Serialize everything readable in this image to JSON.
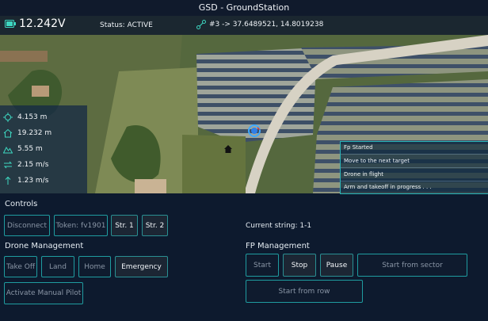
{
  "window": {
    "title": "GSD - GroundStation"
  },
  "statusbar": {
    "battery_voltage": "12.242V",
    "status": "Status: ACTIVE",
    "waypoint": "#3 -> 37.6489521, 14.8019238"
  },
  "telemetry": [
    {
      "icon": "altitude-icon",
      "value": "4.153 m"
    },
    {
      "icon": "home-distance-icon",
      "value": "19.232 m"
    },
    {
      "icon": "terrain-height-icon",
      "value": "5.55 m"
    },
    {
      "icon": "horizontal-speed-icon",
      "value": "2.15 m/s"
    },
    {
      "icon": "vertical-speed-icon",
      "value": "1.23 m/s"
    }
  ],
  "log": [
    "Fp Started",
    "Move to the next target",
    "Drone in flight",
    "Arm and takeoff in progress . . ."
  ],
  "controls": {
    "title": "Controls",
    "disconnect": "Disconnect",
    "token": "Token: fv1901",
    "str1": "Str. 1",
    "str2": "Str. 2",
    "current_string": "Current string: 1-1"
  },
  "drone_management": {
    "title": "Drone Management",
    "take_off": "Take Off",
    "land": "Land",
    "home": "Home",
    "emergency": "Emergency",
    "manual_pilot": "Activate Manual Pilot"
  },
  "fp_management": {
    "title": "FP Management",
    "start": "Start",
    "stop": "Stop",
    "pause": "Pause",
    "start_sector": "Start from sector",
    "start_row": "Start from row"
  },
  "colors": {
    "accent": "#1f9ca0",
    "background": "#0d1a2e"
  }
}
